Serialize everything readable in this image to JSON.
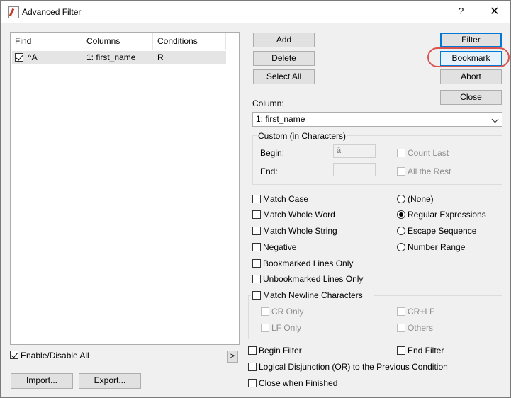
{
  "window": {
    "title": "Advanced Filter",
    "help": "?",
    "close": "✕"
  },
  "list": {
    "headers": [
      "Find",
      "Columns",
      "Conditions"
    ],
    "rows": [
      {
        "find": "^A",
        "columns": "1: first_name",
        "conditions": "R"
      }
    ]
  },
  "left": {
    "enable_all": "Enable/Disable All",
    "arrow": ">",
    "import": "Import...",
    "export": "Export..."
  },
  "buttons": {
    "add": "Add",
    "delete": "Delete",
    "select_all": "Select All",
    "filter": "Filter",
    "bookmark": "Bookmark",
    "abort": "Abort",
    "close": "Close"
  },
  "column": {
    "label": "Column:",
    "value": "1: first_name"
  },
  "custom": {
    "title": "Custom (in Characters)",
    "begin": "Begin:",
    "begin_value": "ā",
    "end": "End:",
    "count_last": "Count Last",
    "all_rest": "All the Rest"
  },
  "options": {
    "match_case": "Match Case",
    "match_whole_word": "Match Whole Word",
    "match_whole_string": "Match Whole String",
    "negative": "Negative",
    "bookmarked_only": "Bookmarked Lines Only",
    "unbookmarked_only": "Unbookmarked Lines Only",
    "match_newline": "Match Newline Characters"
  },
  "radios": {
    "none": "(None)",
    "regex": "Regular Expressions",
    "escape": "Escape Sequence",
    "range": "Number Range"
  },
  "newline": {
    "cr_only": "CR Only",
    "crlf": "CR+LF",
    "lf_only": "LF Only",
    "others": "Others"
  },
  "bottom": {
    "begin_filter": "Begin Filter",
    "end_filter": "End Filter",
    "logical_or": "Logical Disjunction (OR) to the Previous Condition",
    "close_when_finished": "Close when Finished"
  }
}
